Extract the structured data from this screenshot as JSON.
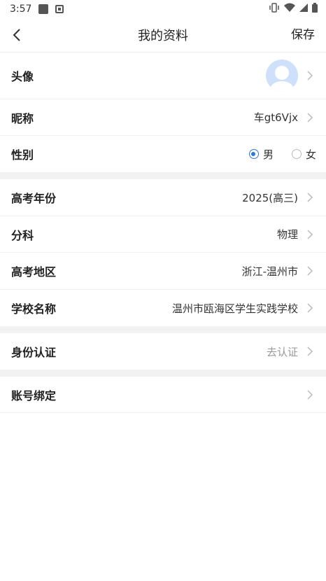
{
  "status_bar": {
    "time": "3:57"
  },
  "nav": {
    "title": "我的资料",
    "save_label": "保存"
  },
  "profile": {
    "avatar_label": "头像",
    "nickname_label": "昵称",
    "nickname_value": "车gt6Vjx",
    "gender_label": "性别",
    "gender_options": [
      "男",
      "女"
    ],
    "gender_selected": "男"
  },
  "academic": {
    "exam_year_label": "高考年份",
    "exam_year_value": "2025(高三)",
    "subject_label": "分科",
    "subject_value": "物理",
    "region_label": "高考地区",
    "region_value": "浙江-温州市",
    "school_label": "学校名称",
    "school_value": "温州市瓯海区学生实践学校"
  },
  "identity": {
    "label": "身份认证",
    "value": "去认证"
  },
  "account": {
    "label": "账号绑定"
  },
  "colors": {
    "accent": "#2b7bd6",
    "divider": "#f2f2f2",
    "avatar_bg": "#cfe0fb"
  }
}
